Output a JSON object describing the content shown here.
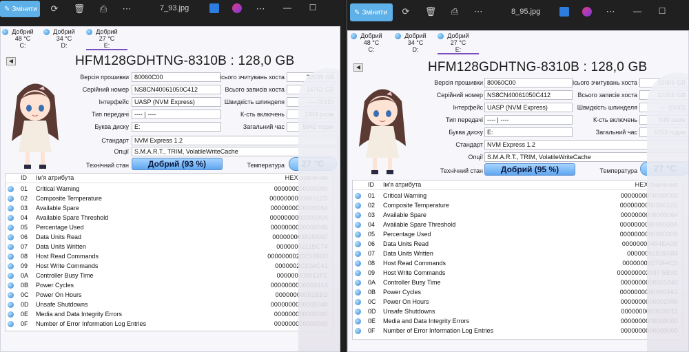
{
  "windows": [
    {
      "filename": "7_93.jpg",
      "edit_label": "Змінити",
      "drives": [
        {
          "status": "Добрий",
          "temp": "48 °C",
          "letter": "C:"
        },
        {
          "status": "Добрий",
          "temp": "34 °C",
          "letter": "D:"
        },
        {
          "status": "Добрий",
          "temp": "27 °C",
          "letter": "E:"
        }
      ],
      "model": "HFM128GDHTNG-8310B : 128,0 GB",
      "labels": {
        "firmware": "Версія прошивки",
        "serial": "Серійний номер",
        "interface": "Інтерфейс",
        "transfer": "Тип передачі",
        "drive_letter": "Буква диску",
        "standard": "Стандарт",
        "options": "Опції",
        "health": "Технічний стан",
        "host_reads": "ісього зчитувань хоста",
        "host_writes": "Всього записів хоста",
        "rotation": "Швидкість шпинделя",
        "power_count": "К-сть включень",
        "power_time": "Загальний час",
        "temperature": "Температура"
      },
      "values": {
        "firmware": "80060C00",
        "serial": "NS8CN40061050C412",
        "interface": "UASP (NVM Express)",
        "transfer": "---- | ----",
        "drive_letter": "E:",
        "standard": "NVM Express 1.2",
        "options": "S.M.A.R.T., TRIM, VolatileWriteCache",
        "health": "Добрий  (93 %)",
        "host_reads": "22039 GB",
        "host_writes": "14762 GB",
        "rotation": "---- (SSD)",
        "power_count": "1394 разів",
        "power_time": "5842 годин",
        "temperature": "27 °C"
      },
      "table_headers": {
        "id": "ID",
        "name": "Ім'я атрибута",
        "hex": "HEX-значення"
      },
      "attributes": [
        {
          "id": "01",
          "name": "Critical Warning",
          "hex": "000000000000000"
        },
        {
          "id": "02",
          "name": "Composite Temperature",
          "hex": "000000000000012D"
        },
        {
          "id": "03",
          "name": "Available Spare",
          "hex": "0000000000000064"
        },
        {
          "id": "04",
          "name": "Available Spare Threshold",
          "hex": "000000000000000A"
        },
        {
          "id": "05",
          "name": "Percentage Used",
          "hex": "0000000000000006"
        },
        {
          "id": "06",
          "name": "Data Units Read",
          "hex": "00000000382E6AF"
        },
        {
          "id": "07",
          "name": "Data Units Written",
          "hex": "0000000211BC74"
        },
        {
          "id": "08",
          "name": "Host Read Commands",
          "hex": "000000002CC599D0"
        },
        {
          "id": "09",
          "name": "Host Write Commands",
          "hex": "0000002C33AC41"
        },
        {
          "id": "0A",
          "name": "Controller Busy Time",
          "hex": "000000000012FE"
        },
        {
          "id": "0B",
          "name": "Power Cycles",
          "hex": "0000000000000414"
        },
        {
          "id": "0C",
          "name": "Power On Hours",
          "hex": "00000000001BBD"
        },
        {
          "id": "0D",
          "name": "Unsafe Shutdowns",
          "hex": "0000000000000048"
        },
        {
          "id": "0E",
          "name": "Media and Data Integrity Errors",
          "hex": "000000000000000"
        },
        {
          "id": "0F",
          "name": "Number of Error Information Log Entries",
          "hex": "000000000000000"
        }
      ]
    },
    {
      "filename": "8_95.jpg",
      "edit_label": "Змінити",
      "drives": [
        {
          "status": "Добрий",
          "temp": "48 °C",
          "letter": "C:"
        },
        {
          "status": "Добрий",
          "temp": "34 °C",
          "letter": "D:"
        },
        {
          "status": "Добрий",
          "temp": "27 °C",
          "letter": "E:"
        }
      ],
      "model": "HFM128GDHTNG-8310B : 128,0 GB",
      "labels": {
        "firmware": "Версія прошивки",
        "serial": "Серійний номер",
        "interface": "Інтерфейс",
        "transfer": "Тип передачі",
        "drive_letter": "Буква диску",
        "standard": "Стандарт",
        "options": "Опції",
        "health": "Технічний стан",
        "host_reads": "ісього зчитувань хоста",
        "host_writes": "Всього записів хоста",
        "rotation": "Швидкість шпинделя",
        "power_count": "К-сть включень",
        "power_time": "Загальний час",
        "temperature": "Температура"
      },
      "values": {
        "firmware": "80060C00",
        "serial": "NS8CN40061050C412",
        "interface": "UASP (NVM Express)",
        "transfer": "---- | ----",
        "drive_letter": "E:",
        "standard": "NVM Express 1.2",
        "options": "S.M.A.R.T., TRIM, VolatileWriteCache",
        "health": "Добрий  (95 %)",
        "host_reads": "15906 GB",
        "host_writes": "10206 GB",
        "rotation": "---- (SSD)",
        "power_count": "939 разів",
        "power_time": "5255 годин",
        "temperature": "27 °C"
      },
      "table_headers": {
        "id": "ID",
        "name": "Ім'я атрибута",
        "hex": "HEX-значення"
      },
      "attributes": [
        {
          "id": "01",
          "name": "Critical Warning",
          "hex": "0000000000000000"
        },
        {
          "id": "02",
          "name": "Composite Temperature",
          "hex": "000000000000012E"
        },
        {
          "id": "03",
          "name": "Available Spare",
          "hex": "0000000000000064"
        },
        {
          "id": "04",
          "name": "Available Spare Threshold",
          "hex": "000000000000000A"
        },
        {
          "id": "05",
          "name": "Percentage Used",
          "hex": "000000000000000B"
        },
        {
          "id": "06",
          "name": "Data Units Read",
          "hex": "00000000494EA0E"
        },
        {
          "id": "07",
          "name": "Data Units Written",
          "hex": "00000002B36884"
        },
        {
          "id": "08",
          "name": "Host Read Commands",
          "hex": "00000004078FAC0"
        },
        {
          "id": "09",
          "name": "Host Write Commands",
          "hex": "000000003937 5B9D"
        },
        {
          "id": "0A",
          "name": "Controller Busy Time",
          "hex": "0000000000001840"
        },
        {
          "id": "0B",
          "name": "Power Cycles",
          "hex": "00000000000004A1"
        },
        {
          "id": "0C",
          "name": "Power On Hours",
          "hex": "0000000000002595"
        },
        {
          "id": "0D",
          "name": "Unsafe Shutdowns",
          "hex": "0000000000000011"
        },
        {
          "id": "0E",
          "name": "Media and Data Integrity Errors",
          "hex": "0000000000000000"
        },
        {
          "id": "0F",
          "name": "Number of Error Information Log Entries",
          "hex": "0000000000000000"
        }
      ]
    }
  ]
}
